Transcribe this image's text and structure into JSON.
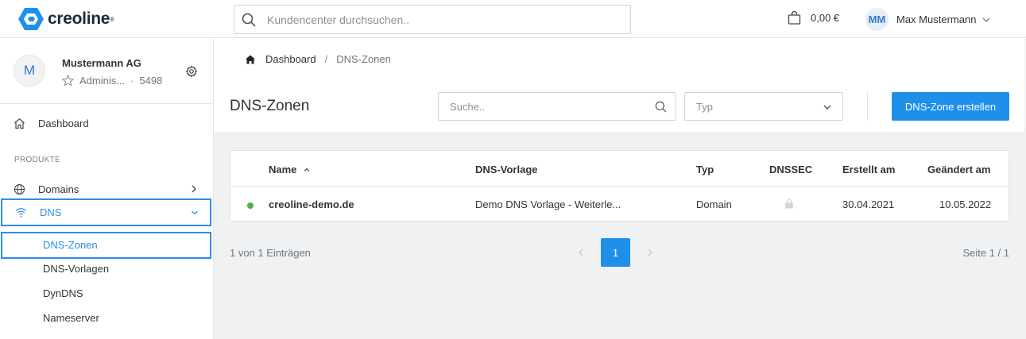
{
  "header": {
    "logo_text": "creoline",
    "logo_mark": "®",
    "search_placeholder": "Kundencenter durchsuchen..",
    "cart_amount": "0,00 €",
    "user_initials": "MM",
    "user_name": "Max Mustermann"
  },
  "account": {
    "avatar_letter": "M",
    "name": "Mustermann AG",
    "role": "Adminis...",
    "separator": "·",
    "number": "5498"
  },
  "sidebar": {
    "dashboard": "Dashboard",
    "section_products": "PRODUKTE",
    "domains": "Domains",
    "dns": "DNS",
    "sub": {
      "dns_zones": "DNS-Zonen",
      "dns_templates": "DNS-Vorlagen",
      "dyndns": "DynDNS",
      "nameserver": "Nameserver"
    }
  },
  "breadcrumb": {
    "home": "Dashboard",
    "sep": "/",
    "current": "DNS-Zonen"
  },
  "page": {
    "title": "DNS-Zonen",
    "search_placeholder": "Suche..",
    "type_placeholder": "Typ",
    "create_button": "DNS-Zone erstellen"
  },
  "table": {
    "columns": {
      "name": "Name",
      "template": "DNS-Vorlage",
      "type": "Typ",
      "dnssec": "DNSSEC",
      "created": "Erstellt am",
      "changed": "Geändert am"
    },
    "rows": [
      {
        "name": "creoline-demo.de",
        "template": "Demo DNS Vorlage - Weiterle...",
        "type": "Domain",
        "created": "30.04.2021",
        "changed": "10.05.2022"
      }
    ]
  },
  "pagination": {
    "entries_info": "1 von 1 Einträgen",
    "current_page": "1",
    "page_info": "Seite 1 / 1"
  },
  "colors": {
    "accent": "#1e90ec",
    "status_active": "#4caf50"
  }
}
